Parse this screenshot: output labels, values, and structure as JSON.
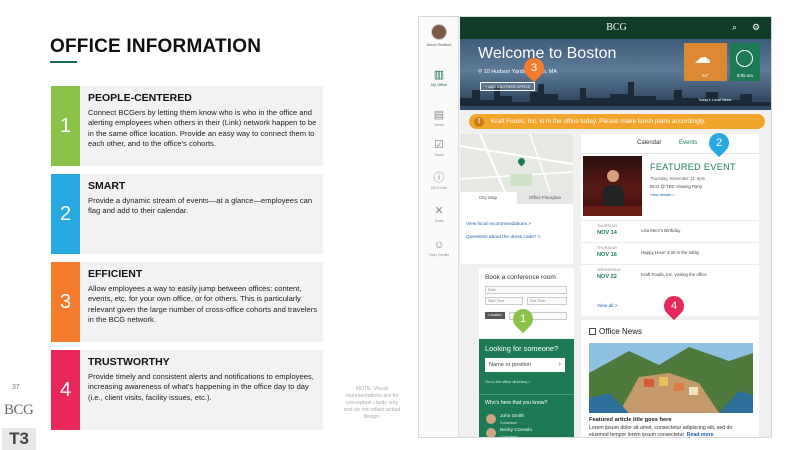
{
  "slide": {
    "title": "OFFICE INFORMATION",
    "page_number": "37",
    "logo_text": "BCG",
    "section_badge": "T3",
    "footnote": "NOTE: Visual representations are for conceptual clarity only and do not reflect actual design.",
    "cards": [
      {
        "number": "1",
        "title": "PEOPLE-CENTERED",
        "color": "#8bc34a",
        "body": "Connect BCGers by letting them know who is who in the office and alerting employees when others in their (Link) network happen to be in the same office location. Provide an easy way to connect them to each other, and to the office's cohorts."
      },
      {
        "number": "2",
        "title": "SMART",
        "color": "#29a9e1",
        "body": "Provide a dynamic stream of events—at a glance—employees can flag and add to their calendar."
      },
      {
        "number": "3",
        "title": "EFFICIENT",
        "color": "#f47c2c",
        "body": "Allow employees a way to easily jump between offices: content, events, etc. for your own office, or for others. This is particularly relevant given the large number of cross-office cohorts and travelers in the BCG network."
      },
      {
        "number": "4",
        "title": "TRUSTWORTHY",
        "color": "#e8285a",
        "body": "Provide timely and consistent alerts and notifications to employees, increasing awareness of what's happening in the office day to day (i.e., client visits, facility issues, etc.)."
      }
    ]
  },
  "app": {
    "brand": "BCG",
    "user_name": "Alexis Redford",
    "nav": [
      {
        "label": "My Office",
        "icon": "building-icon",
        "active": true
      },
      {
        "label": "News",
        "icon": "news-icon"
      },
      {
        "label": "Tasks",
        "icon": "tasks-icon"
      },
      {
        "label": "BCG Info",
        "icon": "info-icon"
      },
      {
        "label": "Tools",
        "icon": "tools-icon"
      },
      {
        "label": "Help Center",
        "icon": "help-icon"
      }
    ],
    "hero": {
      "welcome": "Welcome to Boston",
      "address": "10 Hudson Yards, Boston, MA",
      "change_office": "+ ADD ANOTHER OFFICE",
      "weather_label": "64°",
      "time_label": "9:55 am",
      "local_note": "Today's Local News"
    },
    "alert": "Kraft Foods, Inc. is in the office today. Please make lunch plans accordingly.",
    "map": {
      "tabs": [
        "City Map",
        "Office Floorplan"
      ],
      "links": [
        "View local recommendations >",
        "Questions about the dress code? >"
      ]
    },
    "conference": {
      "title": "Book a conference room",
      "fields": [
        "Date",
        "Start Time",
        "End Time",
        "Location"
      ],
      "button": "Book"
    },
    "lookup": {
      "title": "Looking for someone?",
      "placeholder": "Name or position",
      "sub": "Go to the office directory >"
    },
    "who": {
      "title": "Who's here that you know?",
      "people": [
        {
          "name": "John Smith",
          "role": "Consultant"
        },
        {
          "name": "Becky Consolo",
          "role": "Consultant"
        }
      ]
    },
    "events": {
      "tabs": [
        "Calendar",
        "Events"
      ],
      "featured_label": "FEATURED EVENT",
      "featured_date": "Thursday, November 14, 6pm",
      "featured_desc": "BCG @ TED Viewing Party",
      "featured_more": "View details >",
      "items": [
        {
          "dow": "THURSDAY",
          "date": "NOV 14",
          "text": "Lisa Merz's Birthday"
        },
        {
          "dow": "THURSDAY",
          "date": "NOV 16",
          "text": "Happy Hour! 4:30 in the lobby"
        },
        {
          "dow": "WEDNESDAY",
          "date": "NOV 22",
          "text": "Kraft Foods, Inc. visiting the office"
        }
      ],
      "view_all": "View all >"
    },
    "news": {
      "title": "Office News",
      "article_title": "Featured article title goes here",
      "article_desc": "Lorem ipsum dolor sit amet, consectetur adipiscing elit, sed do eiusmod tempor lorem ipsum consectetur.",
      "read_more": "Read more"
    },
    "markers": [
      {
        "n": "1",
        "color": "#8bc34a"
      },
      {
        "n": "2",
        "color": "#29a9e1"
      },
      {
        "n": "3",
        "color": "#f47c2c"
      },
      {
        "n": "4",
        "color": "#e8285a"
      }
    ]
  }
}
